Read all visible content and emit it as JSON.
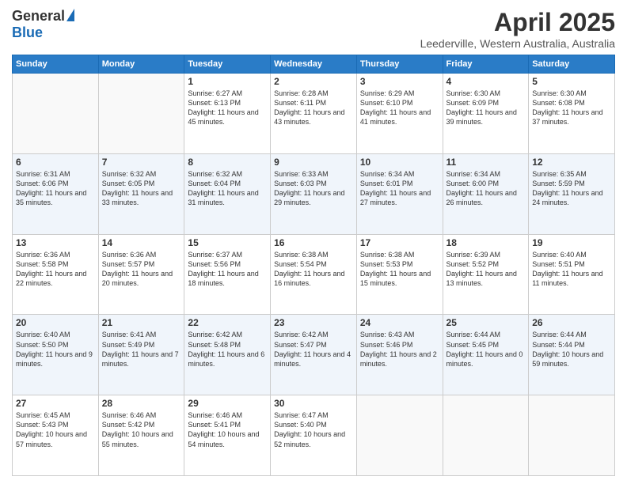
{
  "header": {
    "logo_general": "General",
    "logo_blue": "Blue",
    "month_year": "April 2025",
    "location": "Leederville, Western Australia, Australia"
  },
  "days_of_week": [
    "Sunday",
    "Monday",
    "Tuesday",
    "Wednesday",
    "Thursday",
    "Friday",
    "Saturday"
  ],
  "weeks": [
    [
      {
        "day": "",
        "info": ""
      },
      {
        "day": "",
        "info": ""
      },
      {
        "day": "1",
        "info": "Sunrise: 6:27 AM\nSunset: 6:13 PM\nDaylight: 11 hours and 45 minutes."
      },
      {
        "day": "2",
        "info": "Sunrise: 6:28 AM\nSunset: 6:11 PM\nDaylight: 11 hours and 43 minutes."
      },
      {
        "day": "3",
        "info": "Sunrise: 6:29 AM\nSunset: 6:10 PM\nDaylight: 11 hours and 41 minutes."
      },
      {
        "day": "4",
        "info": "Sunrise: 6:30 AM\nSunset: 6:09 PM\nDaylight: 11 hours and 39 minutes."
      },
      {
        "day": "5",
        "info": "Sunrise: 6:30 AM\nSunset: 6:08 PM\nDaylight: 11 hours and 37 minutes."
      }
    ],
    [
      {
        "day": "6",
        "info": "Sunrise: 6:31 AM\nSunset: 6:06 PM\nDaylight: 11 hours and 35 minutes."
      },
      {
        "day": "7",
        "info": "Sunrise: 6:32 AM\nSunset: 6:05 PM\nDaylight: 11 hours and 33 minutes."
      },
      {
        "day": "8",
        "info": "Sunrise: 6:32 AM\nSunset: 6:04 PM\nDaylight: 11 hours and 31 minutes."
      },
      {
        "day": "9",
        "info": "Sunrise: 6:33 AM\nSunset: 6:03 PM\nDaylight: 11 hours and 29 minutes."
      },
      {
        "day": "10",
        "info": "Sunrise: 6:34 AM\nSunset: 6:01 PM\nDaylight: 11 hours and 27 minutes."
      },
      {
        "day": "11",
        "info": "Sunrise: 6:34 AM\nSunset: 6:00 PM\nDaylight: 11 hours and 26 minutes."
      },
      {
        "day": "12",
        "info": "Sunrise: 6:35 AM\nSunset: 5:59 PM\nDaylight: 11 hours and 24 minutes."
      }
    ],
    [
      {
        "day": "13",
        "info": "Sunrise: 6:36 AM\nSunset: 5:58 PM\nDaylight: 11 hours and 22 minutes."
      },
      {
        "day": "14",
        "info": "Sunrise: 6:36 AM\nSunset: 5:57 PM\nDaylight: 11 hours and 20 minutes."
      },
      {
        "day": "15",
        "info": "Sunrise: 6:37 AM\nSunset: 5:56 PM\nDaylight: 11 hours and 18 minutes."
      },
      {
        "day": "16",
        "info": "Sunrise: 6:38 AM\nSunset: 5:54 PM\nDaylight: 11 hours and 16 minutes."
      },
      {
        "day": "17",
        "info": "Sunrise: 6:38 AM\nSunset: 5:53 PM\nDaylight: 11 hours and 15 minutes."
      },
      {
        "day": "18",
        "info": "Sunrise: 6:39 AM\nSunset: 5:52 PM\nDaylight: 11 hours and 13 minutes."
      },
      {
        "day": "19",
        "info": "Sunrise: 6:40 AM\nSunset: 5:51 PM\nDaylight: 11 hours and 11 minutes."
      }
    ],
    [
      {
        "day": "20",
        "info": "Sunrise: 6:40 AM\nSunset: 5:50 PM\nDaylight: 11 hours and 9 minutes."
      },
      {
        "day": "21",
        "info": "Sunrise: 6:41 AM\nSunset: 5:49 PM\nDaylight: 11 hours and 7 minutes."
      },
      {
        "day": "22",
        "info": "Sunrise: 6:42 AM\nSunset: 5:48 PM\nDaylight: 11 hours and 6 minutes."
      },
      {
        "day": "23",
        "info": "Sunrise: 6:42 AM\nSunset: 5:47 PM\nDaylight: 11 hours and 4 minutes."
      },
      {
        "day": "24",
        "info": "Sunrise: 6:43 AM\nSunset: 5:46 PM\nDaylight: 11 hours and 2 minutes."
      },
      {
        "day": "25",
        "info": "Sunrise: 6:44 AM\nSunset: 5:45 PM\nDaylight: 11 hours and 0 minutes."
      },
      {
        "day": "26",
        "info": "Sunrise: 6:44 AM\nSunset: 5:44 PM\nDaylight: 10 hours and 59 minutes."
      }
    ],
    [
      {
        "day": "27",
        "info": "Sunrise: 6:45 AM\nSunset: 5:43 PM\nDaylight: 10 hours and 57 minutes."
      },
      {
        "day": "28",
        "info": "Sunrise: 6:46 AM\nSunset: 5:42 PM\nDaylight: 10 hours and 55 minutes."
      },
      {
        "day": "29",
        "info": "Sunrise: 6:46 AM\nSunset: 5:41 PM\nDaylight: 10 hours and 54 minutes."
      },
      {
        "day": "30",
        "info": "Sunrise: 6:47 AM\nSunset: 5:40 PM\nDaylight: 10 hours and 52 minutes."
      },
      {
        "day": "",
        "info": ""
      },
      {
        "day": "",
        "info": ""
      },
      {
        "day": "",
        "info": ""
      }
    ]
  ]
}
